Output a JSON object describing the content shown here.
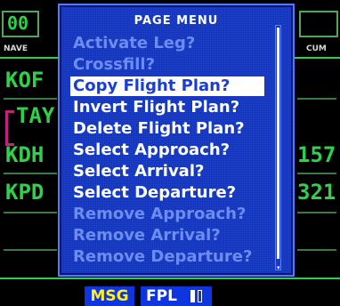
{
  "menu": {
    "title": "PAGE MENU",
    "items": [
      {
        "label": "Activate Leg?",
        "state": "disabled"
      },
      {
        "label": "Crossfill?",
        "state": "disabled"
      },
      {
        "label": "Copy Flight Plan?",
        "state": "selected"
      },
      {
        "label": "Invert Flight Plan?",
        "state": "enabled"
      },
      {
        "label": "Delete Flight Plan?",
        "state": "enabled"
      },
      {
        "label": "Select Approach?",
        "state": "enabled"
      },
      {
        "label": "Select Arrival?",
        "state": "enabled"
      },
      {
        "label": "Select Departure?",
        "state": "enabled"
      },
      {
        "label": "Remove Approach?",
        "state": "disabled"
      },
      {
        "label": "Remove Arrival?",
        "state": "disabled"
      },
      {
        "label": "Remove Departure?",
        "state": "disabled"
      }
    ]
  },
  "background": {
    "top_left_value": "00",
    "left_header": "NAVE",
    "right_header": "CUM",
    "waypoints": [
      "KOF",
      "TAY",
      "KDH",
      "KPD"
    ],
    "right_values": [
      "157",
      "321"
    ]
  },
  "status_bar": {
    "msg_label": "MSG",
    "page_label": "FPL"
  },
  "colors": {
    "menu_bg": "#1a3fd0",
    "enabled_text": "#ffffff",
    "disabled_text": "#6d8cf0",
    "msg_text": "#ffee20",
    "waypoint_green": "#2fd14a"
  }
}
